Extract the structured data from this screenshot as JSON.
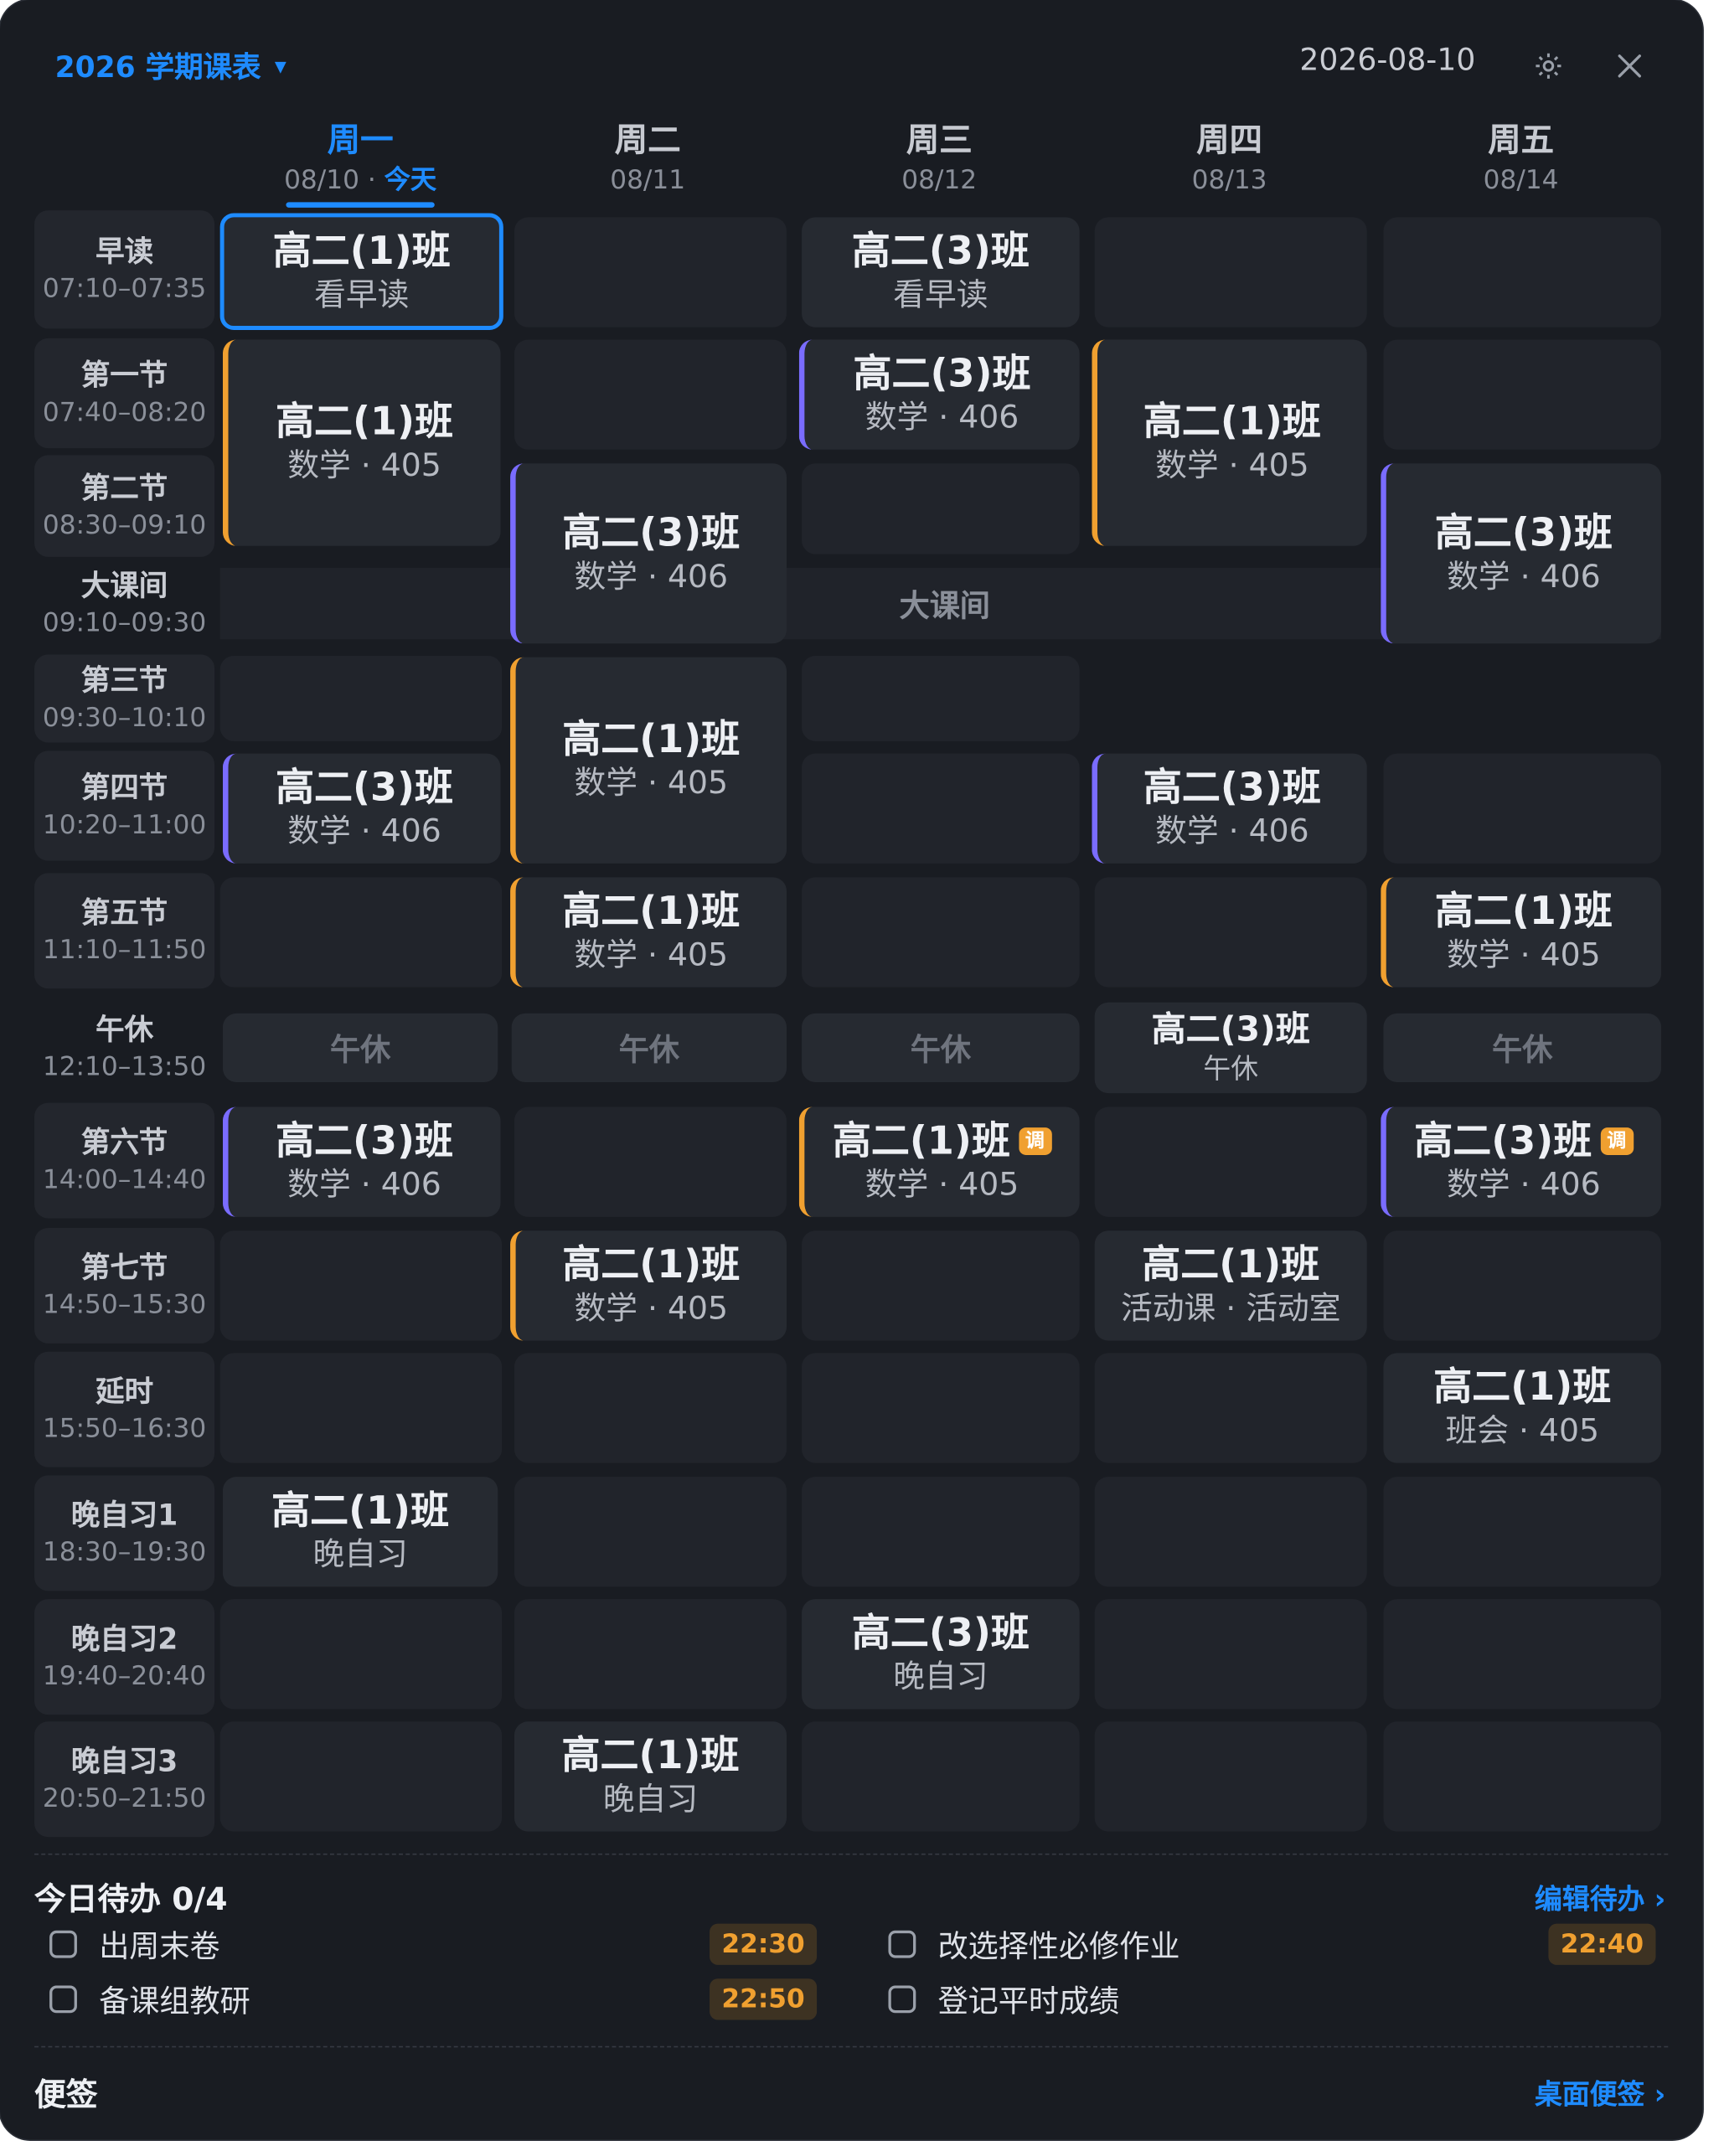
{
  "header": {
    "title": "2026 学期课表",
    "date": "2026-08-10"
  },
  "days": [
    {
      "name": "周一",
      "date": "08/10",
      "today_label": "今天"
    },
    {
      "name": "周二",
      "date": "08/11"
    },
    {
      "name": "周三",
      "date": "08/12"
    },
    {
      "name": "周四",
      "date": "08/13"
    },
    {
      "name": "周五",
      "date": "08/14"
    }
  ],
  "periods": [
    {
      "name": "早读",
      "time": "07:10–07:35"
    },
    {
      "name": "第一节",
      "time": "07:40–08:20"
    },
    {
      "name": "第二节",
      "time": "08:30–09:10"
    },
    {
      "name": "大课间",
      "time": "09:10–09:30"
    },
    {
      "name": "第三节",
      "time": "09:30–10:10"
    },
    {
      "name": "第四节",
      "time": "10:20–11:00"
    },
    {
      "name": "第五节",
      "time": "11:10–11:50"
    },
    {
      "name": "午休",
      "time": "12:10–13:50"
    },
    {
      "name": "第六节",
      "time": "14:00–14:40"
    },
    {
      "name": "第七节",
      "time": "14:50–15:30"
    },
    {
      "name": "延时",
      "time": "15:50–16:30"
    },
    {
      "name": "晚自习1",
      "time": "18:30–19:30"
    },
    {
      "name": "晚自习2",
      "time": "19:40–20:40"
    },
    {
      "name": "晚自习3",
      "time": "20:50–21:50"
    }
  ],
  "break_label": "大课间",
  "lunch_label": "午休",
  "lessons": [
    {
      "class": "高二(1)班",
      "sub": "看早读"
    },
    {
      "class": "高二(3)班",
      "sub": "看早读"
    },
    {
      "class": "高二(1)班",
      "sub": "数学 · 405"
    },
    {
      "class": "高二(3)班",
      "sub": "数学 · 406"
    },
    {
      "class": "高二(1)班",
      "sub": "数学 · 405"
    },
    {
      "class": "高二(3)班",
      "sub": "数学 · 406"
    },
    {
      "class": "高二(3)班",
      "sub": "数学 · 406"
    },
    {
      "class": "高二(1)班",
      "sub": "数学 · 405"
    },
    {
      "class": "高二(3)班",
      "sub": "数学 · 406"
    },
    {
      "class": "高二(3)班",
      "sub": "数学 · 406"
    },
    {
      "class": "高二(1)班",
      "sub": "数学 · 405"
    },
    {
      "class": "高二(1)班",
      "sub": "数学 · 405"
    },
    {
      "class": "高二(3)班",
      "sub": "午休"
    },
    {
      "class": "高二(3)班",
      "sub": "数学 · 406"
    },
    {
      "class": "高二(1)班",
      "sub": "数学 · 405",
      "badge": "调"
    },
    {
      "class": "高二(3)班",
      "sub": "数学 · 406",
      "badge": "调"
    },
    {
      "class": "高二(1)班",
      "sub": "数学 · 405"
    },
    {
      "class": "高二(1)班",
      "sub": "活动课 · 活动室"
    },
    {
      "class": "高二(1)班",
      "sub": "班会 · 405"
    },
    {
      "class": "高二(1)班",
      "sub": "晚自习"
    },
    {
      "class": "高二(3)班",
      "sub": "晚自习"
    },
    {
      "class": "高二(1)班",
      "sub": "晚自习"
    }
  ],
  "todo": {
    "title": "今日待办 0/4",
    "edit_label": "编辑待办 ›",
    "items": [
      {
        "text": "出周末卷",
        "time": "22:30",
        "checked": false
      },
      {
        "text": "改选择性必修作业",
        "time": "22:40",
        "checked": false
      },
      {
        "text": "备课组教研",
        "time": "22:50",
        "checked": false
      },
      {
        "text": "登记平时成绩",
        "time": "",
        "checked": false
      }
    ]
  },
  "notes": {
    "title": "便签",
    "link_label": "桌面便签 ›"
  },
  "colors": {
    "accent": "#1e8bff",
    "class1": "#f0a030",
    "class3": "#7a6cff",
    "background": "#191c22"
  }
}
